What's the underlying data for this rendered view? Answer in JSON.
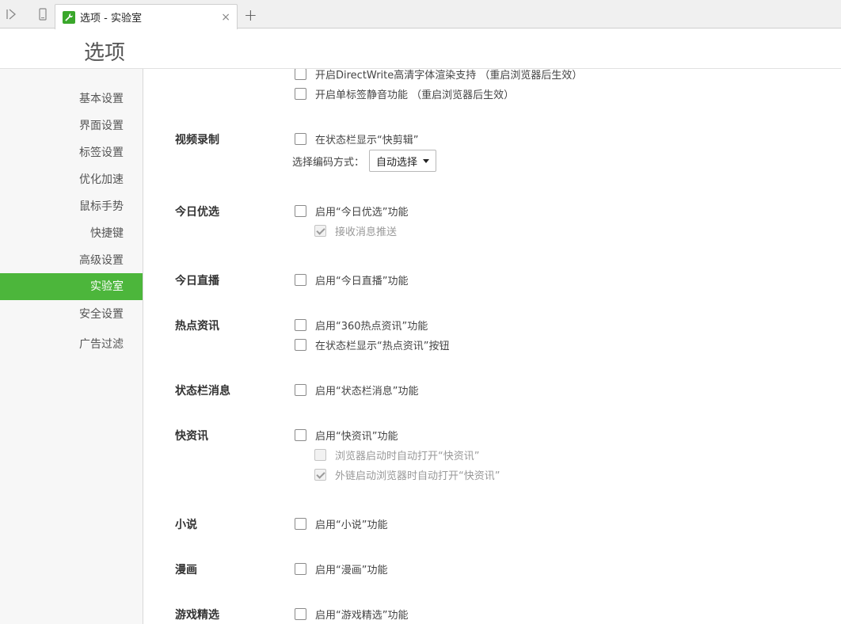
{
  "tab": {
    "title": "选项 - 实验室",
    "close": "×",
    "new_tab": "+"
  },
  "header": {
    "title": "选项"
  },
  "sidebar": {
    "items": [
      {
        "label": "基本设置"
      },
      {
        "label": "界面设置"
      },
      {
        "label": "标签设置"
      },
      {
        "label": "优化加速"
      },
      {
        "label": "鼠标手势"
      },
      {
        "label": "快捷键"
      },
      {
        "label": "高级设置"
      },
      {
        "label": "实验室",
        "active": true
      },
      {
        "label": "安全设置"
      },
      {
        "label": "广告过滤"
      }
    ]
  },
  "content": {
    "top_options": [
      {
        "label": "开启DirectWrite高清字体渲染支持 （重启浏览器后生效）",
        "checked": false
      },
      {
        "label": "开启单标签静音功能 （重启浏览器后生效）",
        "checked": false
      }
    ],
    "sections": {
      "video": {
        "label": "视频录制",
        "option": "在状态栏显示“快剪辑”",
        "codec_label": "选择编码方式：",
        "codec_value": "自动选择"
      },
      "today_pick": {
        "label": "今日优选",
        "option": "启用“今日优选”功能",
        "sub": "接收消息推送"
      },
      "today_live": {
        "label": "今日直播",
        "option": "启用“今日直播”功能"
      },
      "hot_news": {
        "label": "热点资讯",
        "option1": "启用“360热点资讯”功能",
        "option2": "在状态栏显示“热点资讯”按钮"
      },
      "statusbar_msg": {
        "label": "状态栏消息",
        "option": "启用“状态栏消息”功能"
      },
      "quick_news": {
        "label": "快资讯",
        "option": "启用“快资讯”功能",
        "sub1": "浏览器启动时自动打开“快资讯”",
        "sub2": "外链启动浏览器时自动打开“快资讯”"
      },
      "novel": {
        "label": "小说",
        "option": "启用“小说”功能"
      },
      "comic": {
        "label": "漫画",
        "option": "启用“漫画”功能"
      },
      "games": {
        "label": "游戏精选",
        "option": "启用“游戏精选”功能"
      }
    }
  },
  "colors": {
    "accent": "#4cb63b",
    "favicon": "#3aa72b"
  }
}
